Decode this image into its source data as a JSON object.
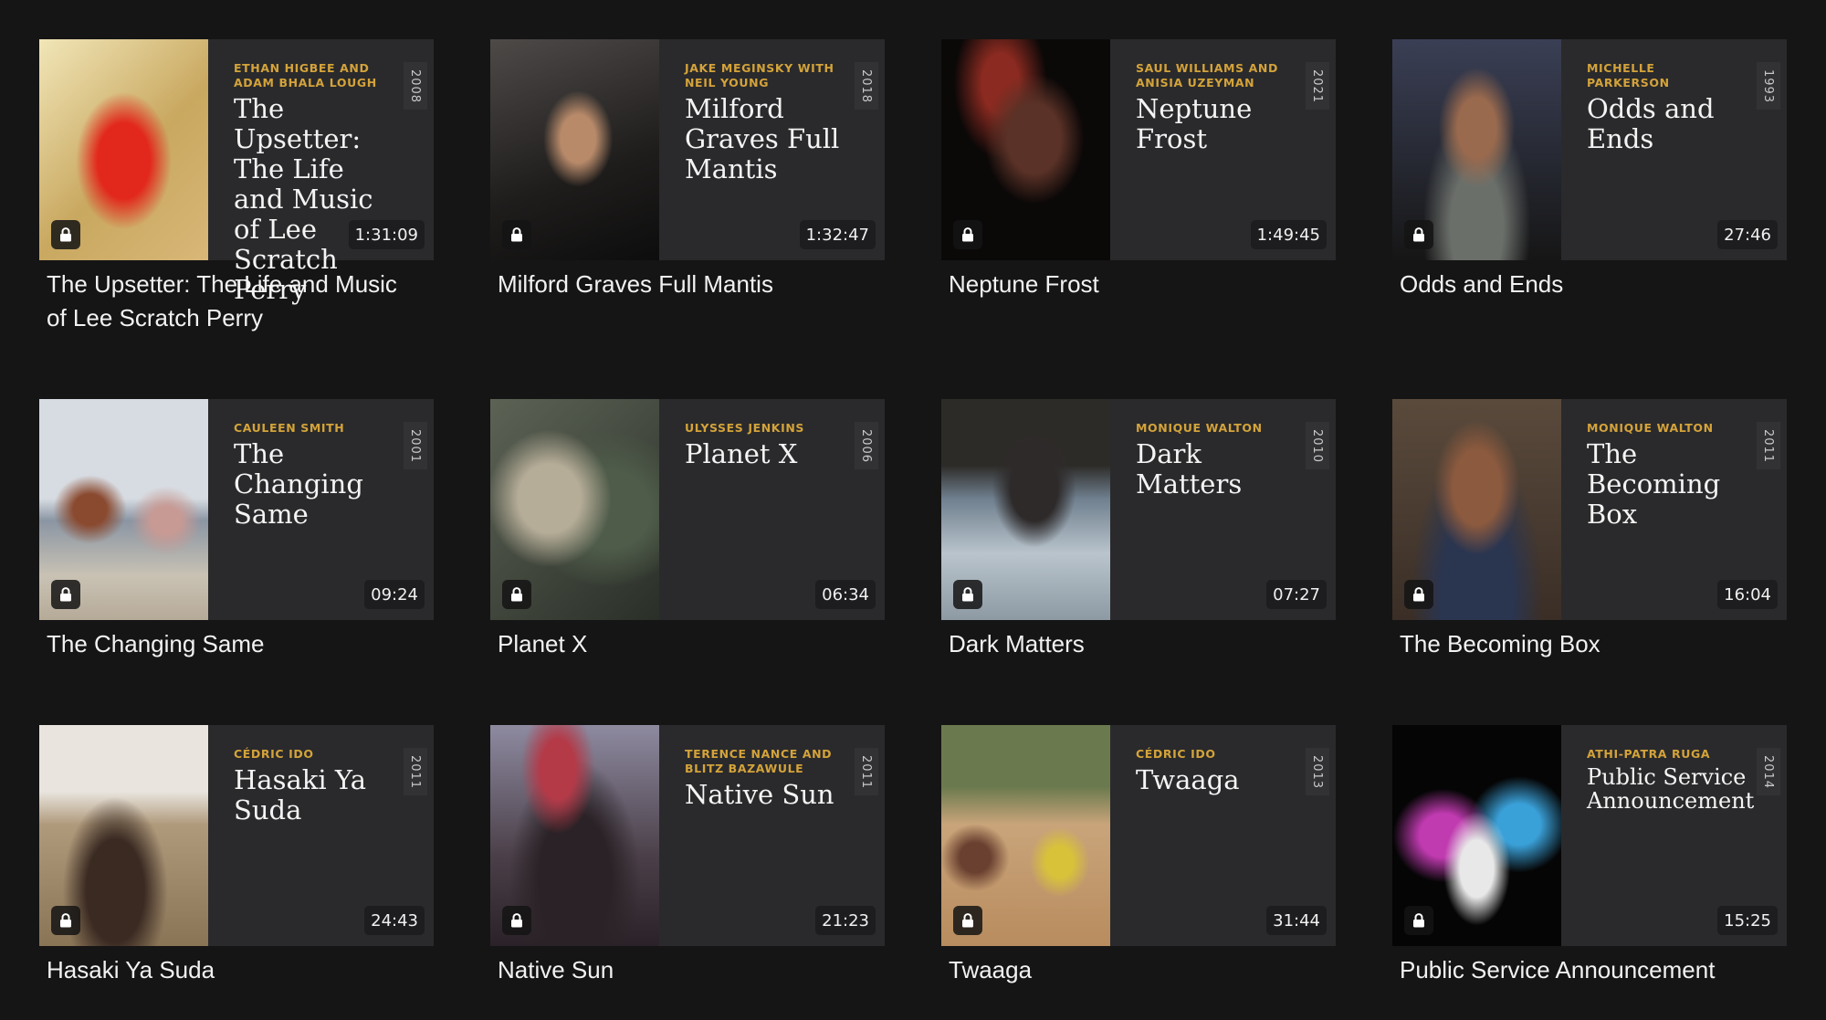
{
  "films": [
    {
      "director": "ETHAN HIGBEE AND ADAM BHALA LOUGH",
      "title": "The Upsetter: The Life and Music of Lee Scratch Perry",
      "year": "2008",
      "duration": "1:31:09",
      "caption": "The Upsetter: The Life and Music of Lee Scratch Perry"
    },
    {
      "director": "JAKE MEGINSKY WITH NEIL YOUNG",
      "title": "Milford Graves Full Mantis",
      "year": "2018",
      "duration": "1:32:47",
      "caption": "Milford Graves Full Mantis"
    },
    {
      "director": "SAUL WILLIAMS AND ANISIA UZEYMAN",
      "title": "Neptune Frost",
      "year": "2021",
      "duration": "1:49:45",
      "caption": "Neptune Frost"
    },
    {
      "director": "MICHELLE PARKERSON",
      "title": "Odds and Ends",
      "year": "1993",
      "duration": "27:46",
      "caption": "Odds and Ends"
    },
    {
      "director": "CAULEEN SMITH",
      "title": "The Changing Same",
      "year": "2001",
      "duration": "09:24",
      "caption": "The Changing Same"
    },
    {
      "director": "ULYSSES JENKINS",
      "title": "Planet X",
      "year": "2006",
      "duration": "06:34",
      "caption": "Planet X"
    },
    {
      "director": "MONIQUE WALTON",
      "title": "Dark Matters",
      "year": "2010",
      "duration": "07:27",
      "caption": "Dark Matters"
    },
    {
      "director": "MONIQUE WALTON",
      "title": "The Becoming Box",
      "year": "2011",
      "duration": "16:04",
      "caption": "The Becoming Box"
    },
    {
      "director": "CÉDRIC IDO",
      "title": "Hasaki Ya Suda",
      "year": "2011",
      "duration": "24:43",
      "caption": "Hasaki Ya Suda"
    },
    {
      "director": "TERENCE NANCE AND BLITZ BAZAWULE",
      "title": "Native Sun",
      "year": "2011",
      "duration": "21:23",
      "caption": "Native Sun"
    },
    {
      "director": "CÉDRIC IDO",
      "title": "Twaaga",
      "year": "2013",
      "duration": "31:44",
      "caption": "Twaaga"
    },
    {
      "director": "ATHI-PATRA RUGA",
      "title": "Public Service Announcement",
      "year": "2014",
      "duration": "15:25",
      "caption": "Public Service Announcement"
    }
  ],
  "colors": {
    "background": "#151515",
    "tile": "#2a2a2c",
    "director_accent": "#d4a33a"
  },
  "icons": {
    "lock": "lock-icon"
  }
}
